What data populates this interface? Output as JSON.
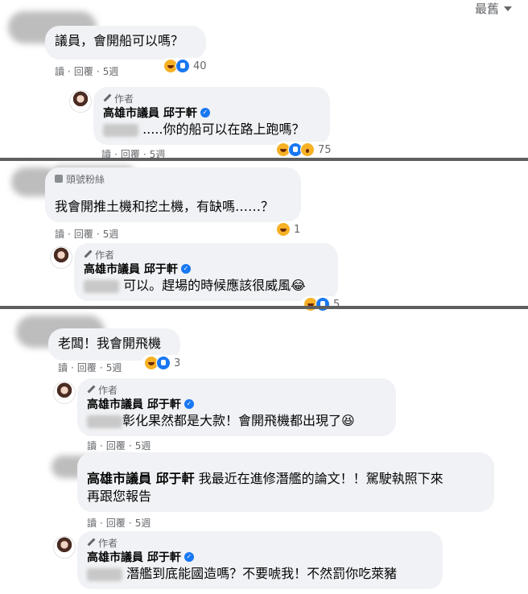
{
  "sort_label": "最舊",
  "meta": {
    "read": "讀",
    "reply": "回覆",
    "time": "5週"
  },
  "author_tag": "作者",
  "fan_tag": "頭號粉絲",
  "page_name": "高雄市議員 邱于軒",
  "verified_glyph": "✓",
  "threads": [
    {
      "comment": "議員，會開船可以嗎？",
      "comment_reaction_count": "40",
      "reply_prefix": "",
      "reply_text": " .....你的船可以在路上跑嗎？",
      "reply_reaction_count": "75"
    },
    {
      "comment": "我會開推土機和挖土機，有缺嗎……？",
      "comment_reaction_count": "1",
      "reply_text": "可以。趕場的時候應該很威風😂",
      "reply_reaction_count": "5"
    },
    {
      "comment": "老闆！我會開飛機",
      "comment_reaction_count": "3",
      "reply_text": "彰化果然都是大款！會開飛機都出現了😆",
      "nested_comment_line1": "我最近在進修潛艦的論文！！駕駛執照下來",
      "nested_comment_line2": "再跟您報告",
      "final_reply_text": "潛艦到底能國造嗎？不要唬我！不然罰你吃萊豬"
    }
  ]
}
